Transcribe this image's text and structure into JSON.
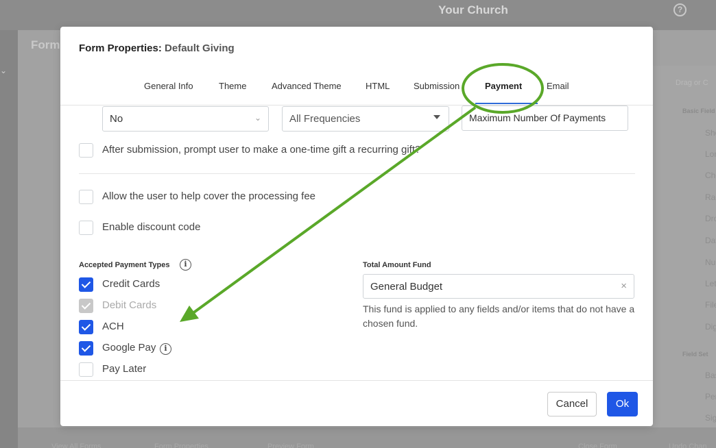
{
  "app": {
    "title": "Your Church",
    "help_glyph": "?",
    "background_heading": "Form",
    "left_chevron": "⌄",
    "right_panel": {
      "drag_text": "Drag or C",
      "basic_fields_label": "Basic Field",
      "items": [
        "Sho",
        "Lon",
        "Che",
        "Rad",
        "Dro",
        "Dat",
        "Nu",
        "Let",
        "File",
        "Dig"
      ],
      "field_sets_label": "Field Set",
      "field_set_items": [
        "Bas",
        "Per",
        "Sig"
      ]
    },
    "footer": [
      "View All Forms",
      "Form Properties",
      "Preview Form",
      "Close Form",
      "Undo Chan"
    ]
  },
  "modal": {
    "title_prefix": "Form Properties:",
    "title_name": "Default Giving",
    "tabs": [
      {
        "label": "General Info",
        "active": false
      },
      {
        "label": "Theme",
        "active": false
      },
      {
        "label": "Advanced Theme",
        "active": false
      },
      {
        "label": "HTML",
        "active": false
      },
      {
        "label": "Submission",
        "active": false
      },
      {
        "label": "Payment",
        "active": true
      },
      {
        "label": "Email",
        "active": false
      }
    ],
    "recurring_select": {
      "value": "No",
      "chevron": "⌄"
    },
    "frequency_select": {
      "value": "All Frequencies"
    },
    "max_payments_input": {
      "placeholder": "Maximum Number Of Payments"
    },
    "options": [
      {
        "label": "After submission, prompt user to make a one-time gift a recurring gift?",
        "checked": false
      },
      {
        "label": "Allow the user to help cover the processing fee",
        "checked": false
      },
      {
        "label": "Enable discount code",
        "checked": false
      }
    ],
    "payment_types_label": "Accepted Payment Types",
    "info_glyph": "i",
    "payment_types": [
      {
        "label": "Credit Cards",
        "state": "checked"
      },
      {
        "label": "Debit Cards",
        "state": "checked-disabled"
      },
      {
        "label": "ACH",
        "state": "checked"
      },
      {
        "label": "Google Pay",
        "state": "checked"
      },
      {
        "label": "Pay Later",
        "state": "unchecked"
      }
    ],
    "fund_label": "Total Amount Fund",
    "fund_value": "General Budget",
    "fund_clear": "×",
    "fund_help": "This fund is applied to any fields and/or items that do not have a chosen fund.",
    "cancel_label": "Cancel",
    "ok_label": "Ok"
  },
  "colors": {
    "accent": "#1f57e6",
    "annotation": "#5aa829",
    "tab_underline": "#2e6bd8"
  }
}
